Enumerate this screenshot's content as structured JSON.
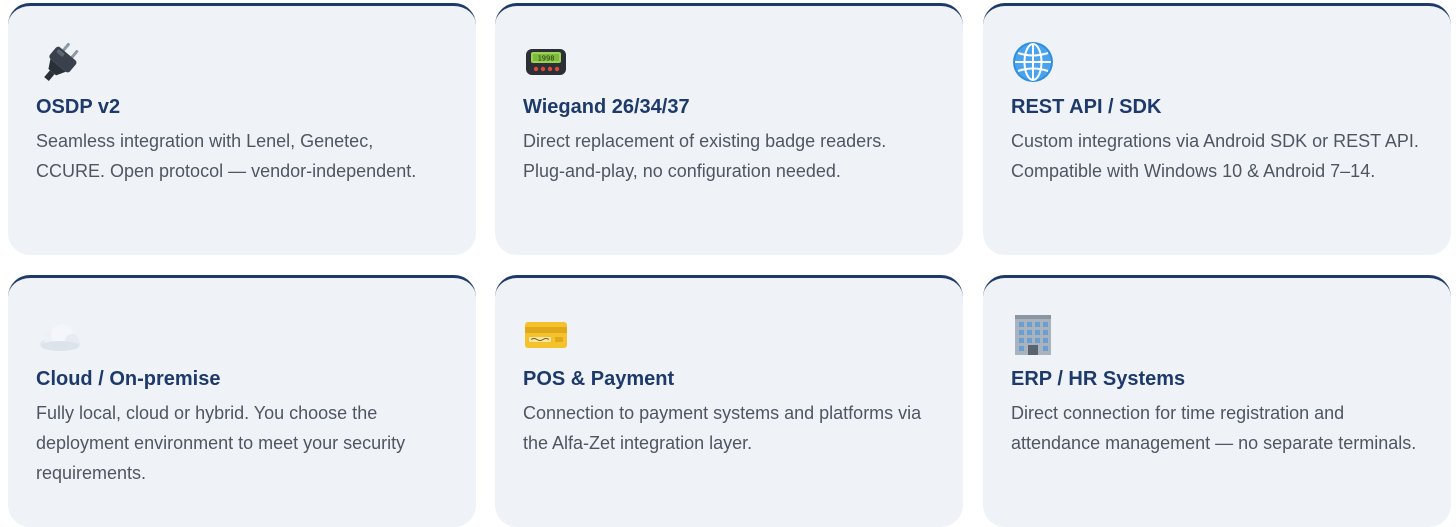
{
  "cards": [
    {
      "icon": "electric-plug-icon",
      "title": "OSDP v2",
      "description": "Seamless integration with Lenel, Genetec, CCURE. Open protocol — vendor-independent."
    },
    {
      "icon": "pager-icon",
      "title": "Wiegand 26/34/37",
      "description": "Direct replacement of existing badge readers. Plug-and-play, no configuration needed."
    },
    {
      "icon": "globe-icon",
      "title": "REST API / SDK",
      "description": "Custom integrations via Android SDK or REST API. Compatible with Windows 10 & Android 7–14."
    },
    {
      "icon": "cloud-icon",
      "title": "Cloud / On-premise",
      "description": "Fully local, cloud or hybrid. You choose the deployment environment to meet your security requirements."
    },
    {
      "icon": "credit-card-icon",
      "title": "POS & Payment",
      "description": "Connection to payment systems and platforms via the Alfa-Zet integration layer."
    },
    {
      "icon": "office-building-icon",
      "title": "ERP / HR Systems",
      "description": "Direct connection for time registration and attendance management — no separate terminals."
    }
  ],
  "colors": {
    "card_background": "#eff3f8",
    "card_border": "#1e3a6b",
    "title": "#1e3a6b",
    "text": "#4f5661"
  }
}
